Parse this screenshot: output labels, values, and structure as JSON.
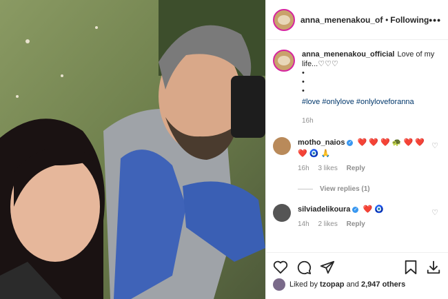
{
  "post": {
    "username": "anna_menenakou_official",
    "header_username": "anna_menenakou_offic",
    "separator": "•",
    "follow_status": "Following",
    "more": "•••",
    "caption_text": "Love of my life...♡♡♡",
    "caption_dots": [
      "•",
      "•",
      "•"
    ],
    "hashtags": "#love #onlylove #onlyloveforanna",
    "time": "16h"
  },
  "comments": [
    {
      "username": "motho_naios",
      "verified": true,
      "text": "❤️ ❤️ ❤️ 🐢 ❤️ ❤️ ❤️ 🧿 🙏",
      "time": "16h",
      "likes": "3 likes",
      "reply": "Reply",
      "avatar_color": "#b98a5a"
    },
    {
      "username": "silviadelikoura",
      "verified": true,
      "text": "❤️ 🧿",
      "time": "14h",
      "likes": "2 likes",
      "reply": "Reply",
      "avatar_color": "#555555"
    }
  ],
  "view_replies": "View replies (1)",
  "likes": {
    "prefix": "Liked by",
    "user": "tzopap",
    "middle": "and",
    "count": "2,947 others"
  },
  "icons": {
    "like": "heart-icon",
    "comment": "comment-icon",
    "share": "share-icon",
    "save": "bookmark-icon",
    "download": "download-icon"
  },
  "colors": {
    "link": "#00376b",
    "verified": "#3897f0",
    "heart": "#ed4956"
  }
}
